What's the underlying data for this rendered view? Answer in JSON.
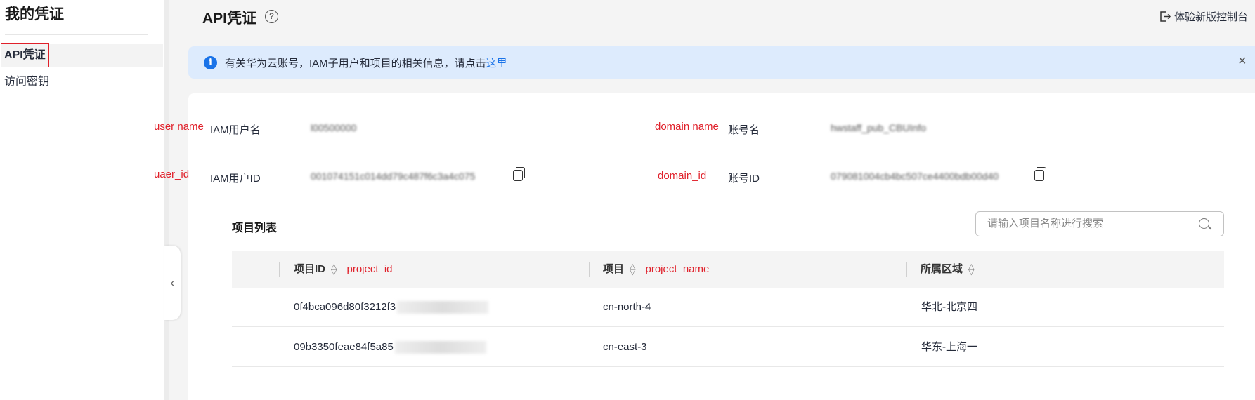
{
  "sidebar": {
    "title": "我的凭证",
    "items": [
      {
        "label": "API凭证",
        "active": true
      },
      {
        "label": "访问密钥"
      }
    ]
  },
  "header": {
    "title": "API凭证",
    "help": "?",
    "new_console": "体验新版控制台"
  },
  "banner": {
    "text": "有关华为云账号，IAM子用户和项目的相关信息，请点击",
    "link": "这里",
    "close": "×"
  },
  "info": {
    "user_name": {
      "annotation": "user name",
      "label": "IAM用户名",
      "value": "l00500000"
    },
    "user_id": {
      "annotation": "uaer_id",
      "label": "IAM用户ID",
      "value": "001074151c014dd79c487f6c3a4c075"
    },
    "domain_name": {
      "annotation": "domain name",
      "label": "账号名",
      "value": "hwstaff_pub_CBUInfo"
    },
    "domain_id": {
      "annotation": "domain_id",
      "label": "账号ID",
      "value": "079081004cb4bc507ce4400bdb00d40"
    }
  },
  "projects": {
    "title": "项目列表",
    "search_placeholder": "请输入项目名称进行搜索",
    "columns": [
      {
        "label": "项目ID",
        "annotation": "project_id"
      },
      {
        "label": "项目",
        "annotation": "project_name"
      },
      {
        "label": "所属区域",
        "annotation": ""
      }
    ],
    "rows": [
      {
        "id": "0f4bca096d80f3212f3",
        "name": "cn-north-4",
        "region": "华北-北京四"
      },
      {
        "id": "09b3350feae84f5a85",
        "name": "cn-east-3",
        "region": "华东-上海一"
      }
    ]
  }
}
